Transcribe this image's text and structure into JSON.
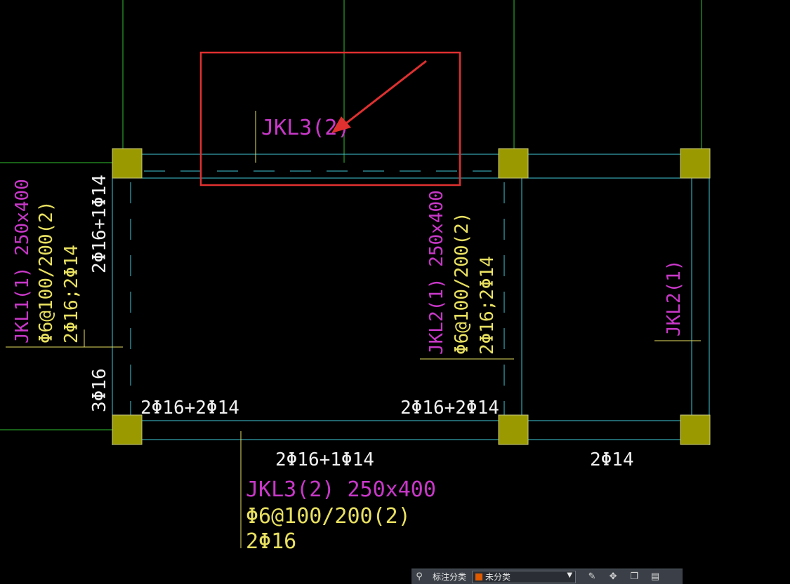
{
  "drawing": {
    "labels": {
      "jkl3_top": "JKL3(2)",
      "jkl1": "JKL1(1) 250x400",
      "jkl1_stirrup": "Φ6@100/200(2)",
      "jkl1_side": "2Φ16;2Φ14",
      "left_top_rebar": "2Φ16+1Φ14",
      "left_bottom_rebar": "3Φ16",
      "jkl2": "JKL2(1) 250x400",
      "jkl2_stirrup": "Φ6@100/200(2)",
      "jkl2_side": "2Φ16;2Φ14",
      "jkl2_right": "JKL2(1)",
      "rebar_bl": "2Φ16+2Φ14",
      "rebar_bm": "2Φ16+2Φ14",
      "rebar_bottom": "2Φ16+1Φ14",
      "rebar_br": "2Φ14",
      "jkl3_bottom": "JKL3(2) 250x400",
      "jkl3_stirrup": "Φ6@100/200(2)",
      "jkl3_rebar": "2Φ16"
    },
    "colors": {
      "magenta": "#c838c8",
      "yellow": "#e8e060",
      "white": "#f0f0f0",
      "cyan": "#40c8d8",
      "green": "#30c030",
      "column": "#9a9a00",
      "highlight": "#e03030"
    }
  },
  "panel": {
    "icons": [
      "filter-icon",
      "edit-icon",
      "move-icon",
      "copy-icon",
      "paste-icon"
    ],
    "label": "标注分类",
    "selected": "未分类"
  }
}
